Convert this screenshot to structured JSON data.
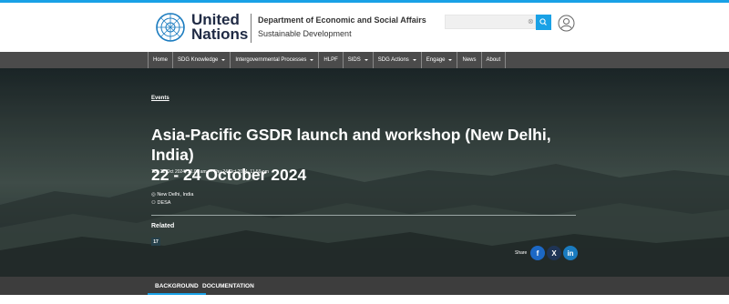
{
  "header": {
    "logo_line1": "United",
    "logo_line2": "Nations",
    "department": "Department of Economic and Social Affairs",
    "subdepartment": "Sustainable Development",
    "search_placeholder": "",
    "search_clear": "⊗"
  },
  "nav": {
    "items": [
      {
        "label": "Home"
      },
      {
        "label": "SDG Knowledge"
      },
      {
        "label": "Intergovernmental Processes"
      },
      {
        "label": "HLPF"
      },
      {
        "label": "SIDS"
      },
      {
        "label": "SDG Actions"
      },
      {
        "label": "Engage"
      },
      {
        "label": "News"
      },
      {
        "label": "About"
      }
    ]
  },
  "event": {
    "category": "Events",
    "title_line1": "Asia-Pacific GSDR launch and workshop (New Delhi, India)",
    "title_line2": "22 - 24 October 2024",
    "datetime": "Tue 22 Oct 2024, 12.00 am — Thu 24 Oct 2024, 11.59 pm",
    "location": "New Delhi, India",
    "organizer": "DESA",
    "related_label": "Related",
    "related_badge": "17",
    "share_label": "Share"
  },
  "share": {
    "facebook": "f",
    "x": "X",
    "linkedin": "in"
  },
  "tabs": {
    "background": "BACKGROUND",
    "documentation": "DOCUMENTATION"
  },
  "colors": {
    "accent": "#19a1e6",
    "nav_bg": "#4b4b4b",
    "facebook": "#1c68c5",
    "linkedin": "#1a7bbf"
  }
}
